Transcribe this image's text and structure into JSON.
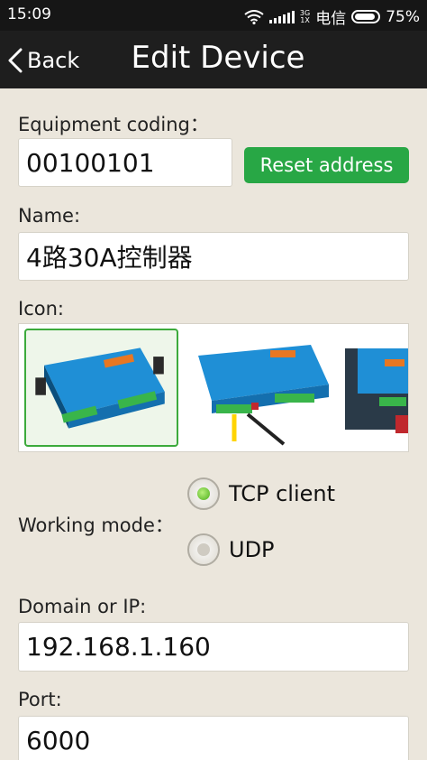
{
  "status_bar": {
    "time": "15:09",
    "network": "3G\n1X",
    "carrier": "电信",
    "battery": "75%"
  },
  "header": {
    "back_label": "Back",
    "title": "Edit Device"
  },
  "form": {
    "equipment_label": "Equipment coding：",
    "equipment_value": "00100101",
    "reset_label": "Reset address",
    "name_label": "Name:",
    "name_value": "4路30A控制器",
    "icon_label": "Icon:",
    "icons": [
      {
        "name": "controller-board-icon-1",
        "selected": true
      },
      {
        "name": "controller-board-icon-2",
        "selected": false
      },
      {
        "name": "controller-board-icon-3",
        "selected": false
      }
    ],
    "mode_label": "Working mode：",
    "modes": [
      {
        "label": "TCP client",
        "selected": true
      },
      {
        "label": "UDP",
        "selected": false
      }
    ],
    "domain_label": "Domain or IP:",
    "domain_value": "192.168.1.160",
    "port_label": "Port:",
    "port_value": "6000"
  },
  "colors": {
    "accent_green": "#28a745",
    "background": "#ebe6dc",
    "bar": "#1e1e1e"
  }
}
